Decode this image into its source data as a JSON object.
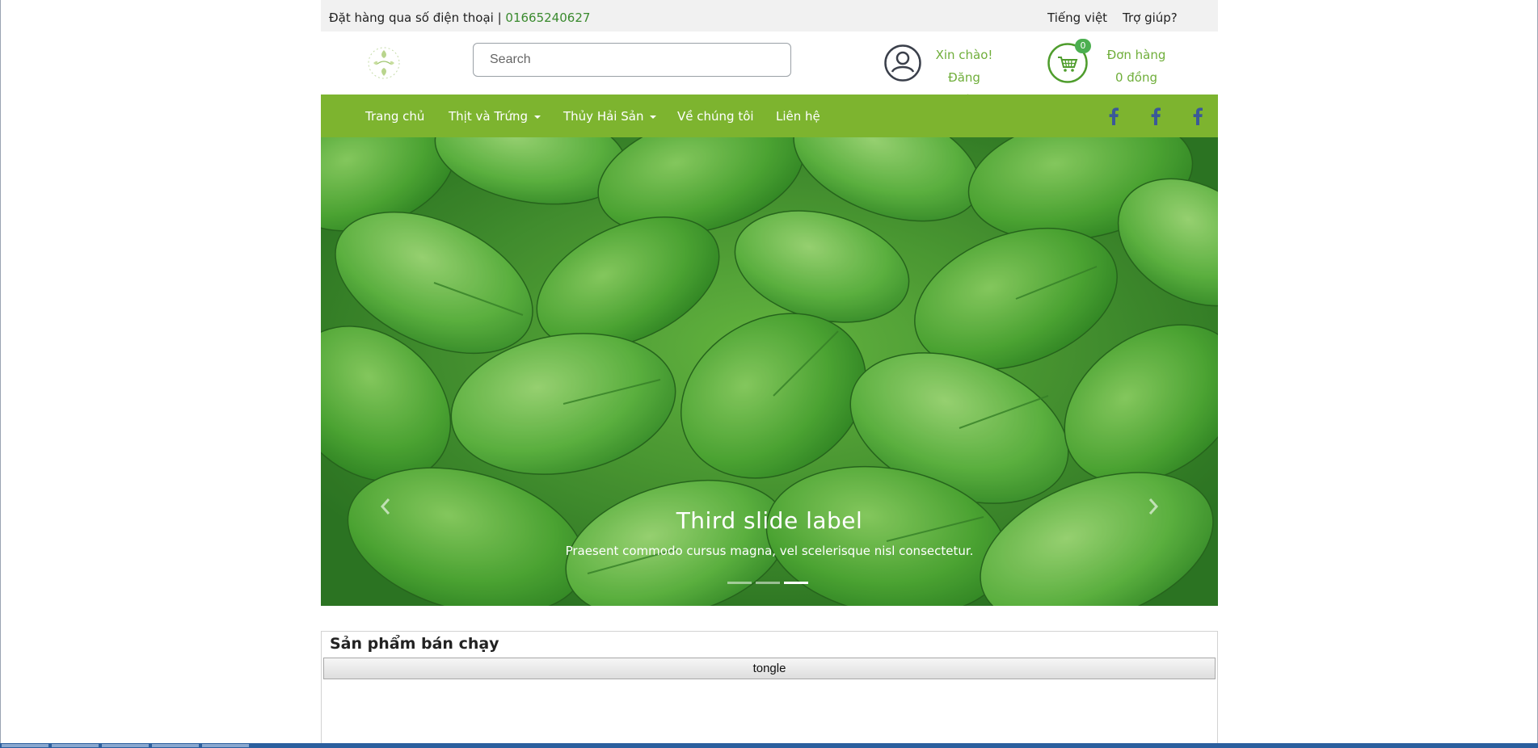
{
  "topbar": {
    "order_label": "Đặt hàng qua số điện thoại | ",
    "phone": "01665240627",
    "language": "Tiếng việt",
    "help": "Trợ giúp?"
  },
  "header": {
    "search_placeholder": "Search",
    "greeting": "Xin chào!",
    "login": "Đăng nhập",
    "cart_count": "0",
    "orders_label": "Đơn hàng",
    "orders_total": "0 đồng"
  },
  "nav": {
    "items": [
      {
        "label": "Trang chủ"
      },
      {
        "label": "Thịt và Trứng"
      },
      {
        "label": "Thủy Hải Sản"
      },
      {
        "label": "Về chúng tôi"
      },
      {
        "label": "Liên hệ"
      }
    ],
    "social_icon": "facebook-icon"
  },
  "carousel": {
    "title": "Third slide label",
    "text": "Praesent commodo cursus magna, vel scelerisque nisl consectetur.",
    "slide_count": 3,
    "active_slide": 3
  },
  "products": {
    "title": "Sản phẩm bán chạy",
    "toggle_label": "tongle"
  },
  "colors": {
    "accent": "#7db42f",
    "link_green": "#6fae3a",
    "phone_green": "#3a8a2e",
    "topbar_bg": "#f1f1f1",
    "social_blue": "#3b5998"
  }
}
